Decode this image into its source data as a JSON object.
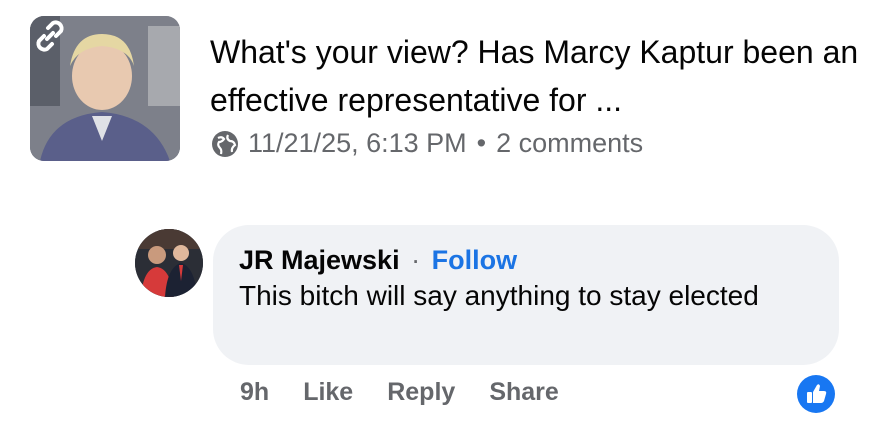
{
  "post": {
    "title": "What's your view? Has Marcy Kaptur been an effective representative for ...",
    "timestamp": "11/21/25, 6:13 PM",
    "comments_count": "2 comments",
    "thumbnail_icon": "link-icon",
    "visibility_icon": "globe-icon"
  },
  "comment": {
    "author": "JR Majewski",
    "separator": "·",
    "follow_label": "Follow",
    "text": "This bitch will say anything to stay elected",
    "time": "9h",
    "like_label": "Like",
    "reply_label": "Reply",
    "share_label": "Share",
    "reaction_icon": "thumbs-up-icon"
  },
  "colors": {
    "accent": "#1877f2",
    "follow": "#1b74e4",
    "muted": "#65676b",
    "bubble": "#f0f2f5"
  }
}
